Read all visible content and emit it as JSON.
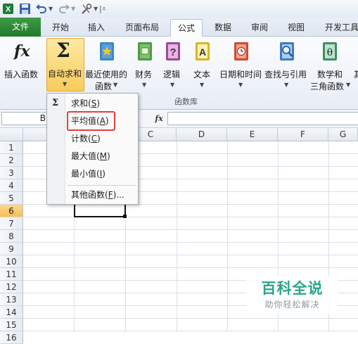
{
  "tabs": {
    "file": "文件",
    "items": [
      "开始",
      "插入",
      "页面布局",
      "公式",
      "数据",
      "审阅",
      "视图",
      "开发工具"
    ],
    "active": "公式"
  },
  "ribbon": {
    "insert_function": "插入函数",
    "autosum": "自动求和",
    "recent_line1": "最近使用的",
    "recent_line2": "函数",
    "finance": "财务",
    "logic": "逻辑",
    "text": "文本",
    "datetime": "日期和时间",
    "lookup": "查找与引用",
    "math_line1": "数学和",
    "math_line2": "三角函数",
    "more": "其",
    "group_label": "函数库"
  },
  "formula_bar": {
    "name_box": "B",
    "fx": "fx",
    "value": ""
  },
  "grid": {
    "columns": [
      "C",
      "D",
      "E",
      "F",
      "G"
    ],
    "rows": [
      "1",
      "2",
      "3",
      "4",
      "5",
      "6",
      "7",
      "8",
      "9",
      "10",
      "11",
      "12",
      "13",
      "14",
      "15",
      "16"
    ],
    "selected_row": "6"
  },
  "autosum_menu": {
    "items": [
      {
        "text": "求和",
        "key": "S"
      },
      {
        "text": "平均值",
        "key": "A"
      },
      {
        "text": "计数",
        "key": "C"
      },
      {
        "text": "最大值",
        "key": "M"
      },
      {
        "text": "最小值",
        "key": "I"
      }
    ],
    "more": {
      "text": "其他函数",
      "key": "F",
      "suffix": "..."
    },
    "highlighted": "平均值"
  },
  "watermark": {
    "title": "百科全说",
    "subtitle": "助你轻松解决"
  },
  "colors": {
    "file_tab": "#2a8a36",
    "accent_gold": "#f8cc5a",
    "highlight_red": "#e0403c",
    "watermark_green": "#2aa58a"
  }
}
